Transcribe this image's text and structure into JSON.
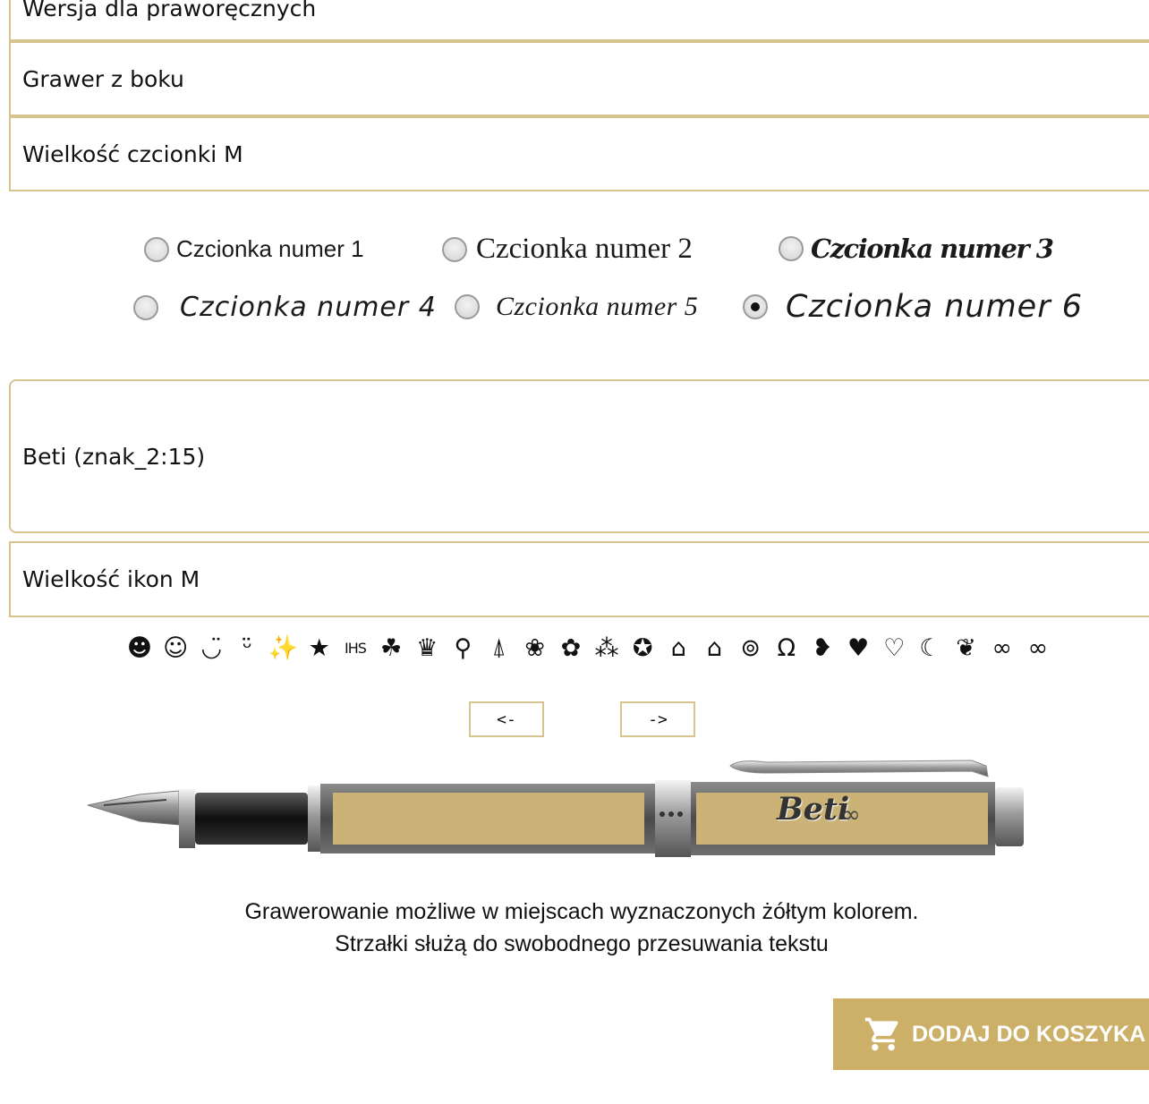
{
  "fields": {
    "hand_version": "Wersja dla praworęcznych",
    "engraving_side": "Grawer z boku",
    "font_size": "Wielkość czcionki M",
    "engraving_text": "Beti (znak_2:15)",
    "icon_size": "Wielkość ikon M"
  },
  "fonts": [
    {
      "label": "Czcionka numer 1",
      "checked": false
    },
    {
      "label": "Czcionka numer 2",
      "checked": false
    },
    {
      "label": "Czcionka numer 3",
      "checked": false
    },
    {
      "label": "Czcionka numer 4",
      "checked": false
    },
    {
      "label": "Czcionka numer 5",
      "checked": false
    },
    {
      "label": "Czcionka numer 6",
      "checked": true
    }
  ],
  "icons": [
    {
      "name": "big-smile-icon",
      "glyph": "☻"
    },
    {
      "name": "smile-icon",
      "glyph": "☺"
    },
    {
      "name": "grin-icon",
      "glyph": "◡̈"
    },
    {
      "name": "grin-wide-icon",
      "glyph": "ᵕ̈"
    },
    {
      "name": "sparkle-icon",
      "glyph": "✨"
    },
    {
      "name": "star-icon",
      "glyph": "★"
    },
    {
      "name": "ihs-icon",
      "glyph": "IHS"
    },
    {
      "name": "clover-icon",
      "glyph": "☘"
    },
    {
      "name": "crown-icon",
      "glyph": "♛"
    },
    {
      "name": "cat-icon",
      "glyph": "⚲"
    },
    {
      "name": "tie-icon",
      "glyph": "⍋"
    },
    {
      "name": "rose-icon",
      "glyph": "❀"
    },
    {
      "name": "rose-bud-icon",
      "glyph": "✿"
    },
    {
      "name": "paw-icon",
      "glyph": "⁂"
    },
    {
      "name": "medal-icon",
      "glyph": "✪"
    },
    {
      "name": "mortarboard-small-icon",
      "glyph": "⌂"
    },
    {
      "name": "mortarboard-icon",
      "glyph": "⌂"
    },
    {
      "name": "rings-icon",
      "glyph": "⊚"
    },
    {
      "name": "horseshoe-icon",
      "glyph": "Ω"
    },
    {
      "name": "half-heart-icon",
      "glyph": "❥"
    },
    {
      "name": "heart-icon",
      "glyph": "♥"
    },
    {
      "name": "heart-outline-icon",
      "glyph": "♡"
    },
    {
      "name": "crescent-icon",
      "glyph": "☾"
    },
    {
      "name": "double-heart-icon",
      "glyph": "❦"
    },
    {
      "name": "infinity-small-icon",
      "glyph": "∞"
    },
    {
      "name": "infinity-icon",
      "glyph": "∞"
    }
  ],
  "arrows": {
    "left": "<-",
    "right": "->"
  },
  "preview": {
    "engraved_text": "Beti",
    "engraved_icon": "∞",
    "accent_color": "#ccb068"
  },
  "info": {
    "line1": "Grawerowanie możliwe w miejscach wyznaczonych żółtym kolorem.",
    "line2": "Strzałki służą do swobodnego przesuwania tekstu"
  },
  "cart": {
    "label": "DODAJ DO KOSZYKA",
    "icon": "cart-icon"
  }
}
